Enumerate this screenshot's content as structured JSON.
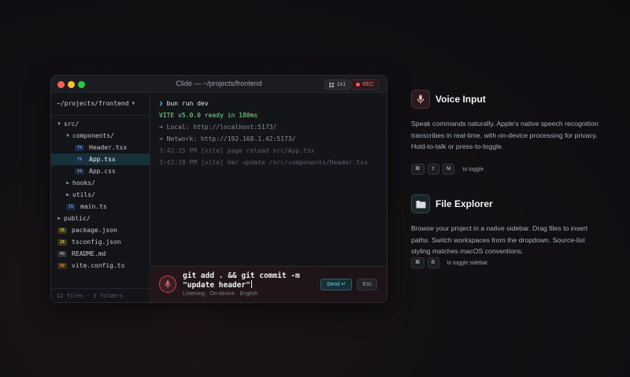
{
  "window": {
    "title": "Clide — ~/projects/frontend",
    "layout_badge": "1x1",
    "rec_label": "REC"
  },
  "sidebar": {
    "workspace": "~/projects/frontend",
    "tree": [
      {
        "label": "src/",
        "type": "folder",
        "open": true,
        "depth": 0
      },
      {
        "label": "components/",
        "type": "folder",
        "open": true,
        "depth": 1
      },
      {
        "label": "Header.tsx",
        "type": "file",
        "badge": "TX",
        "depth": 2
      },
      {
        "label": "App.tsx",
        "type": "file",
        "badge": "TX",
        "depth": 2,
        "selected": true
      },
      {
        "label": "App.css",
        "type": "file",
        "badge": "CS",
        "depth": 2
      },
      {
        "label": "hooks/",
        "type": "folder",
        "open": false,
        "depth": 1
      },
      {
        "label": "utils/",
        "type": "folder",
        "open": false,
        "depth": 1
      },
      {
        "label": "main.ts",
        "type": "file",
        "badge": "TS",
        "depth": 1
      },
      {
        "label": "public/",
        "type": "folder",
        "open": false,
        "depth": 0
      },
      {
        "label": "package.json",
        "type": "file",
        "badge": "JS",
        "depth": 0
      },
      {
        "label": "tsconfig.json",
        "type": "file",
        "badge": "JS",
        "depth": 0
      },
      {
        "label": "README.md",
        "type": "file",
        "badge": "MD",
        "depth": 0
      },
      {
        "label": "vite.config.ts",
        "type": "file",
        "badge": "SV",
        "depth": 0
      }
    ],
    "footer": "12 files · 3 folders"
  },
  "terminal": {
    "command": "bun run dev",
    "ready": "VITE v5.0.0 ready in 180ms",
    "local": "➜ Local: http://localhost:5173/",
    "network": "➜ Network: http://192.168.1.42:5173/",
    "log1": "3:42:15 PM [vite] page reload src/App.tsx",
    "log2": "3:42:18 PM [vite] hmr update /src/components/Header.tsx"
  },
  "input": {
    "dictation_line1": "git add . && git commit -m",
    "dictation_line2": "\"update header\"",
    "status": "Listening · On-device · English",
    "send_label": "Send ↵",
    "esc_label": "Esc"
  },
  "features": {
    "voice": {
      "title": "Voice Input",
      "description": "Speak commands naturally. Apple's native speech recognition transcribes in real-time, with on-device processing for privacy. Hold-to-talk or press-to-toggle.",
      "keys": [
        "⌘",
        "⇧",
        "M"
      ],
      "hint": "to toggle"
    },
    "explorer": {
      "title": "File Explorer",
      "description": "Browse your project in a native sidebar. Drag files to insert paths. Switch workspaces from the dropdown. Source-list styling matches macOS conventions.",
      "keys": [
        "⌘",
        "B"
      ],
      "hint": "to toggle sidebar"
    }
  }
}
